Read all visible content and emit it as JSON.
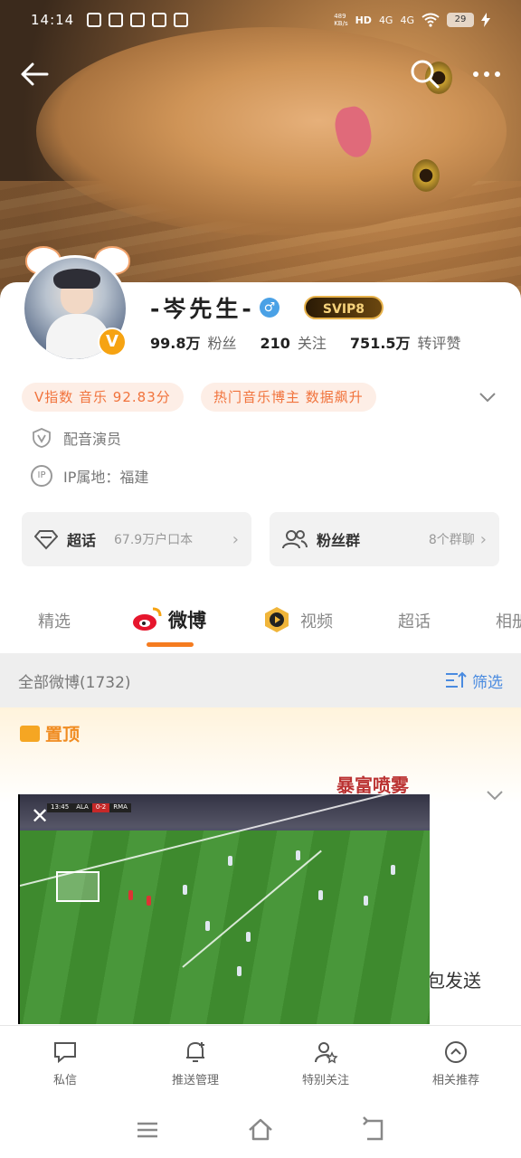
{
  "status_bar": {
    "time": "14:14",
    "net_speed": "489\nKB/s",
    "signal_1": "4G",
    "signal_2": "4G",
    "hd": "HD",
    "battery": "29"
  },
  "header": {
    "back_icon": "arrow-left-icon",
    "search_icon": "search-icon",
    "more_icon": "more-horizontal-icon"
  },
  "profile": {
    "name": "-岑先生-",
    "gender_symbol": "♂",
    "vip_badge": "SVIP8",
    "verified_badge": "V",
    "stats": [
      {
        "num": "99.8万",
        "label": "粉丝"
      },
      {
        "num": "210",
        "label": "关注"
      },
      {
        "num": "751.5万",
        "label": "转评赞"
      }
    ],
    "tags": [
      "V指数 音乐 92.83分",
      "热门音乐博主 数据飙升"
    ],
    "role": "配音演员",
    "ip": "IP属地：福建",
    "ip_icon_text": "IP",
    "chaohua": {
      "label": "超话",
      "sub": "67.9万户口本"
    },
    "fans_group": {
      "label": "粉丝群",
      "sub": "8个群聊"
    }
  },
  "tabs": [
    "精选",
    "微博",
    "视频",
    "超话",
    "相册"
  ],
  "active_tab": "微博",
  "filter_bar": {
    "title": "全部微博(1732)",
    "filter_label": "筛选"
  },
  "pinned": {
    "title": "置顶",
    "sticker_text": "暴富喷雾",
    "post_tail": "包发送"
  },
  "video": {
    "close": "✕",
    "team_left": "ALA",
    "score": "0-2",
    "team_right": "RMA",
    "clock": "13:45"
  },
  "bottom_actions": [
    {
      "label": "私信",
      "icon": "message-icon"
    },
    {
      "label": "推送管理",
      "icon": "bell-plus-icon"
    },
    {
      "label": "特别关注",
      "icon": "user-star-icon"
    },
    {
      "label": "相关推荐",
      "icon": "chevron-up-circle-icon"
    }
  ],
  "nav": [
    "menu-icon",
    "home-icon",
    "back-icon"
  ]
}
